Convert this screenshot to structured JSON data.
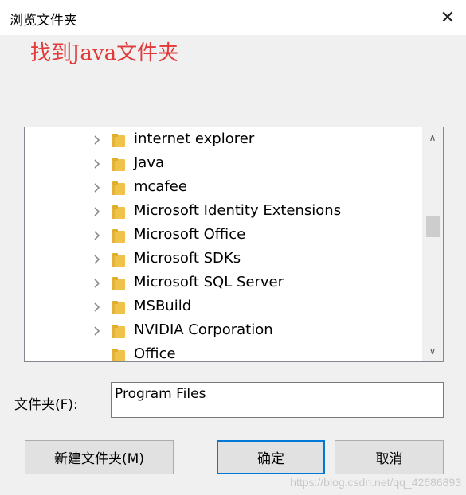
{
  "window": {
    "title": "浏览文件夹",
    "close_glyph": "✕"
  },
  "annotation": {
    "text": "找到Java文件夹",
    "color": "#e23a3a"
  },
  "tree": {
    "items": [
      {
        "label": "internet explorer",
        "expandable": true
      },
      {
        "label": "Java",
        "expandable": true
      },
      {
        "label": "mcafee",
        "expandable": true
      },
      {
        "label": "Microsoft Identity Extensions",
        "expandable": true
      },
      {
        "label": "Microsoft Office",
        "expandable": true
      },
      {
        "label": "Microsoft SDKs",
        "expandable": true
      },
      {
        "label": "Microsoft SQL Server",
        "expandable": true
      },
      {
        "label": "MSBuild",
        "expandable": true
      },
      {
        "label": "NVIDIA Corporation",
        "expandable": true
      },
      {
        "label": "Office",
        "expandable": false
      }
    ],
    "scroll_up_glyph": "∧",
    "scroll_down_glyph": "∨"
  },
  "folder_field": {
    "label": "文件夹(F):",
    "value": "Program Files"
  },
  "buttons": {
    "new_folder": "新建文件夹(M)",
    "ok": "确定",
    "cancel": "取消"
  },
  "watermark": "https://blog.csdn.net/qq_42686893",
  "colors": {
    "accent": "#0078d7",
    "folder": "#f0c24a"
  }
}
